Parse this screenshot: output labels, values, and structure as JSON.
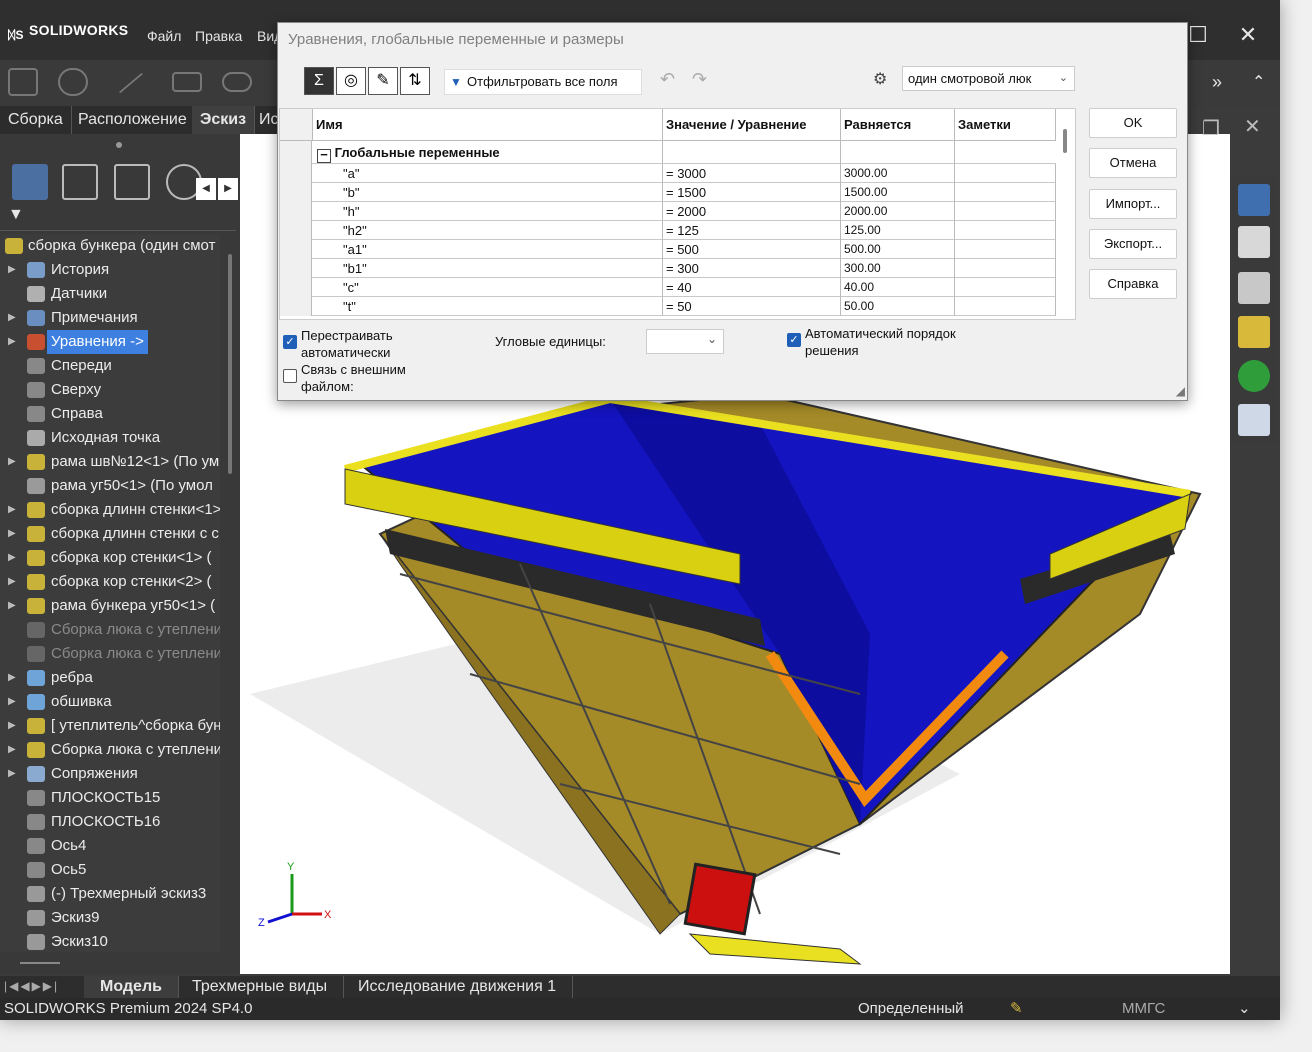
{
  "app": {
    "brand": "SOLIDWORKS",
    "menu": [
      "Файл",
      "Правка",
      "Вид"
    ]
  },
  "command_tabs": [
    "Сборка",
    "Расположение",
    "Эскиз",
    "Ис"
  ],
  "tree": {
    "root": "сборка бункера (один смот",
    "items": [
      {
        "label": "История",
        "arrow": true,
        "icon": "history-icon"
      },
      {
        "label": "Датчики",
        "arrow": false,
        "icon": "sensor-icon"
      },
      {
        "label": "Примечания",
        "arrow": true,
        "icon": "annotation-icon"
      },
      {
        "label": "Уравнения ->",
        "arrow": true,
        "icon": "equation-icon",
        "selected": true
      },
      {
        "label": "Спереди",
        "arrow": false,
        "icon": "plane-icon"
      },
      {
        "label": "Сверху",
        "arrow": false,
        "icon": "plane-icon"
      },
      {
        "label": "Справа",
        "arrow": false,
        "icon": "plane-icon"
      },
      {
        "label": "Исходная точка",
        "arrow": false,
        "icon": "origin-icon"
      },
      {
        "label": "рама шв№12<1> (По ум",
        "arrow": true,
        "icon": "subassembly-icon"
      },
      {
        "label": "рама уг50<1> (По умол",
        "arrow": false,
        "icon": "part-icon"
      },
      {
        "label": "сборка длинн стенки<1>",
        "arrow": true,
        "icon": "subassembly-icon"
      },
      {
        "label": "сборка длинн стенки с с",
        "arrow": true,
        "icon": "subassembly-icon"
      },
      {
        "label": "сборка кор стенки<1> (",
        "arrow": true,
        "icon": "subassembly-icon"
      },
      {
        "label": "сборка кор стенки<2> (",
        "arrow": true,
        "icon": "subassembly-icon"
      },
      {
        "label": "рама бункера уг50<1> (",
        "arrow": true,
        "icon": "subassembly-icon"
      },
      {
        "label": "Сборка люка с утеплени",
        "arrow": false,
        "icon": "suppressed-assembly-icon",
        "dim": true
      },
      {
        "label": "Сборка люка с утеплени",
        "arrow": false,
        "icon": "suppressed-assembly-icon",
        "dim": true
      },
      {
        "label": "ребра",
        "arrow": true,
        "icon": "folder-icon"
      },
      {
        "label": "обшивка",
        "arrow": true,
        "icon": "folder-icon"
      },
      {
        "label": "[ утеплитель^сборка бун",
        "arrow": true,
        "icon": "virtual-part-icon"
      },
      {
        "label": "Сборка люка с утеплени",
        "arrow": true,
        "icon": "subassembly-icon"
      },
      {
        "label": "Сопряжения",
        "arrow": true,
        "icon": "mates-icon"
      },
      {
        "label": "ПЛОСКОСТЬ15",
        "arrow": false,
        "icon": "plane-icon"
      },
      {
        "label": "ПЛОСКОСТЬ16",
        "arrow": false,
        "icon": "plane-icon"
      },
      {
        "label": "Ось4",
        "arrow": false,
        "icon": "axis-icon"
      },
      {
        "label": "Ось5",
        "arrow": false,
        "icon": "axis-icon"
      },
      {
        "label": "(-) Трехмерный эскиз3",
        "arrow": false,
        "icon": "3d-sketch-icon"
      },
      {
        "label": "Эскиз9",
        "arrow": false,
        "icon": "sketch-icon"
      },
      {
        "label": "Эскиз10",
        "arrow": false,
        "icon": "sketch-icon"
      }
    ]
  },
  "dialog": {
    "title": "Уравнения, глобальные переменные и размеры",
    "filter": "Отфильтровать все поля",
    "config": "один смотровой люк",
    "columns": [
      "Имя",
      "Значение / Уравнение",
      "Равняется",
      "Заметки"
    ],
    "group": "Глобальные переменные",
    "rows": [
      {
        "name": "\"a\"",
        "value": "= 3000",
        "result": "3000.00"
      },
      {
        "name": "\"b\"",
        "value": "= 1500",
        "result": "1500.00"
      },
      {
        "name": "\"h\"",
        "value": "= 2000",
        "result": "2000.00"
      },
      {
        "name": "\"h2\"",
        "value": "= 125",
        "result": "125.00"
      },
      {
        "name": "\"a1\"",
        "value": "= 500",
        "result": "500.00"
      },
      {
        "name": "\"b1\"",
        "value": "= 300",
        "result": "300.00"
      },
      {
        "name": "\"c\"",
        "value": "= 40",
        "result": "40.00"
      },
      {
        "name": "\"t\"",
        "value": "= 50",
        "result": "50.00"
      }
    ],
    "buttons": {
      "ok": "OK",
      "cancel": "Отмена",
      "import": "Импорт...",
      "export": "Экспорт...",
      "help": "Справка"
    },
    "rebuild_label": "Перестраивать автоматически",
    "rebuild_checked": true,
    "link_label": "Связь с внешним файлом:",
    "link_checked": false,
    "angular_label": "Угловые единицы:",
    "angular_value": "",
    "auto_order_label": "Автоматический порядок решения",
    "auto_order_checked": true
  },
  "bottom_tabs": [
    "Модель",
    "Трехмерные виды",
    "Исследование движения 1"
  ],
  "status": {
    "product": "SOLIDWORKS Premium 2024 SP4.0",
    "state": "Определенный",
    "units": "ММГС"
  },
  "colors": {
    "selection": "#3d80e0",
    "checkbox": "#1f5fb8",
    "hopper_inner": "#1010c8",
    "hopper_outer": "#b59a28",
    "frame": "#e8e020"
  }
}
